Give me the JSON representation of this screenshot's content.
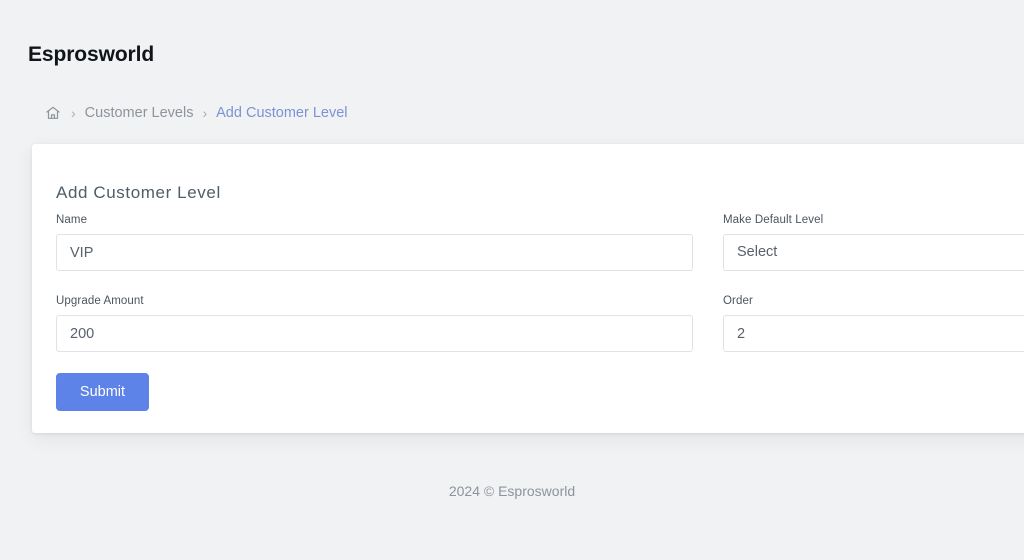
{
  "brand": {
    "name": "Esprosworld"
  },
  "breadcrumb": {
    "home_icon": "home-icon",
    "separator": "›",
    "items": [
      {
        "label": "Customer Levels",
        "active": false
      },
      {
        "label": "Add Customer Level",
        "active": true
      }
    ]
  },
  "card": {
    "title": "Add Customer Level",
    "fields": [
      {
        "label": "Name",
        "value": "VIP",
        "placeholder": "Name",
        "type": "text",
        "name": "name"
      },
      {
        "label": "Make Default Level",
        "value": "Select",
        "placeholder": "Select",
        "type": "select",
        "name": "make-default-level",
        "options": [
          "Select"
        ]
      },
      {
        "label": "Upgrade Amount",
        "value": "200",
        "placeholder": "Upgrade Amount",
        "type": "text",
        "name": "upgrade-amount"
      },
      {
        "label": "Order",
        "value": "2",
        "placeholder": "Order",
        "type": "text",
        "name": "order"
      }
    ],
    "submit_label": "Submit"
  },
  "footer": {
    "text": "2024 © Esprosworld"
  },
  "colors": {
    "page_background": "#f1f2f3",
    "card_background": "#ffffff",
    "accent_button": "#5d82e8",
    "breadcrumb_active": "#7b93d4",
    "breadcrumb_muted": "#8d949c",
    "input_border": "#dfe3e8",
    "title_text": "#505c68"
  }
}
